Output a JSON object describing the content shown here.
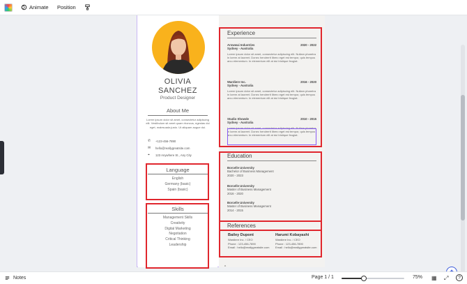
{
  "toolbar": {
    "animate_label": "Animate",
    "position_label": "Position",
    "icons": [
      "color-swatch-icon",
      "animate-icon",
      "paint-format-icon"
    ]
  },
  "resume": {
    "first_name": "OLIVIA",
    "last_name": "SANCHEZ",
    "title": "Product Designer",
    "about_heading": "About Me",
    "about_text": "Lorem ipsum dolor sit amet, consectetur adipiscing elit. Vestibulum sit amet quam rhoncus, egestas dui eget, malesuada justo. Ut aliquam augue dui.",
    "contacts": [
      {
        "icon": "phone-icon",
        "text": "+123-456-7890"
      },
      {
        "icon": "email-icon",
        "text": "hello@reallygreatsite.com"
      },
      {
        "icon": "location-icon",
        "text": "123 Anywhere St., Any City"
      }
    ],
    "language_heading": "Language",
    "languages": [
      "English",
      "Germany (basic)",
      "Spain (basic)"
    ],
    "skills_heading": "Skills",
    "skills": [
      "Management Skills",
      "Creativity",
      "Digital Marketing",
      "Negotiation",
      "Critical Thinking",
      "Leadership"
    ],
    "experience_heading": "Experience",
    "jobs": [
      {
        "company": "Arowwai Industries",
        "years": "2020 - 2022",
        "location": "Sydney - Australia",
        "desc": "Lorem ipsum dolor sit amet, consectetur adipiscing elit. Nullam pharetra in lorem at laoreet. Donec hendrerit libero eget est tempor, quis tempus arcu elementum. In elementum elit at dui tristique feugiat."
      },
      {
        "company": "Wardiere Inc.",
        "years": "2016 - 2020",
        "location": "Sydney - Australia",
        "desc": "Lorem ipsum dolor sit amet, consectetur adipiscing elit. Nullam pharetra in lorem at laoreet. Donec hendrerit libero eget est tempor, quis tempus arcu elementum. In elementum elit at dui tristique feugiat."
      },
      {
        "company": "Studio Showde",
        "years": "2010 - 2015",
        "location": "Sydney - Australia",
        "desc": "Lorem ipsum dolor sit amet, consectetur adipiscing elit. Nullam pharetra in lorem at laoreet. Donec hendrerit libero eget est tempor, quis tempus arcu elementum. In elementum elit at dui tristique feugiat."
      }
    ],
    "education_heading": "Education",
    "education": [
      {
        "school": "Borcelle University",
        "degree": "Bachelor of Business Management",
        "years": "2020 - 2023"
      },
      {
        "school": "Borcelle University",
        "degree": "Master of Business Management",
        "years": "2016 - 2020"
      },
      {
        "school": "Borcelle University",
        "degree": "Master of Business Management",
        "years": "2014 - 2015"
      }
    ],
    "references_heading": "References",
    "references": [
      {
        "name": "Bailey Dupont",
        "role": "Wardiere Inc. / CEO",
        "phone_label": "Phone :",
        "phone": "123-456-7890",
        "email_label": "Email :",
        "email": "hello@reallygreatsite.com"
      },
      {
        "name": "Harumi Kobayashi",
        "role": "Wardiere Inc. / CEO",
        "phone_label": "Phone :",
        "phone": "123-456-7890",
        "email_label": "Email :",
        "email": "hello@reallygreatsite.com"
      }
    ]
  },
  "bottombar": {
    "notes_label": "Notes",
    "page_label": "Page 1 / 1",
    "zoom": "75%",
    "zoom_fraction": 0.35
  },
  "colors": {
    "accent_red": "#e0262d",
    "selection": "#8a5cf6",
    "photo_bg": "#f9b21c"
  }
}
